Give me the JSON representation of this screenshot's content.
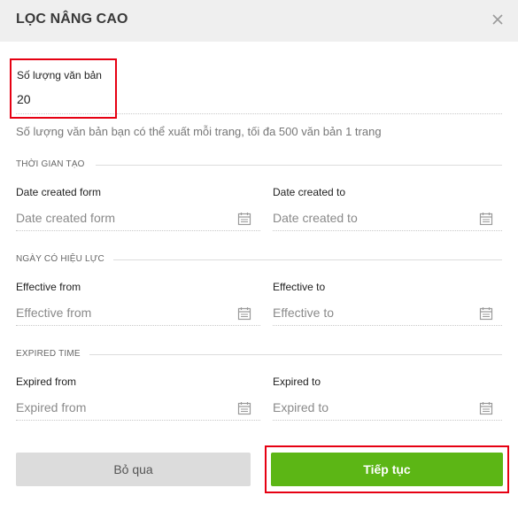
{
  "dialog": {
    "title": "LỌC NÂNG CAO"
  },
  "count": {
    "label": "Số lượng văn bản",
    "value": "20",
    "help": "Số lượng văn bản bạn có thể xuất mỗi trang, tối đa 500 văn bản 1 trang"
  },
  "sections": {
    "created": {
      "title": "THỜI GIAN TẠO",
      "from_label": "Date created form",
      "from_placeholder": "Date created form",
      "to_label": "Date created to",
      "to_placeholder": "Date created to"
    },
    "effective": {
      "title": "NGÀY CÓ HIỆU LỰC",
      "from_label": "Effective from",
      "from_placeholder": "Effective from",
      "to_label": "Effective to",
      "to_placeholder": "Effective to"
    },
    "expired": {
      "title": "EXPIRED TIME",
      "from_label": "Expired from",
      "from_placeholder": "Expired from",
      "to_label": "Expired to",
      "to_placeholder": "Expired to"
    }
  },
  "buttons": {
    "cancel": "Bỏ qua",
    "continue": "Tiếp tục"
  },
  "icons": {
    "close": "close-icon",
    "calendar": "calendar-icon"
  },
  "colors": {
    "accent": "#5cb615",
    "highlight": "#e60012",
    "header_bg": "#efefef"
  }
}
